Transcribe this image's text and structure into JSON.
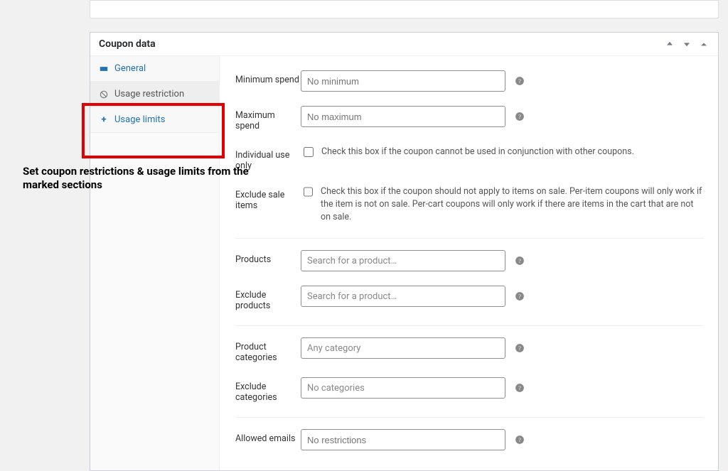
{
  "panel": {
    "title": "Coupon data"
  },
  "tabs": {
    "general": "General",
    "restriction": "Usage restriction",
    "limits": "Usage limits"
  },
  "annotation": "Set coupon restrictions & usage limits from the marked sections",
  "fields": {
    "min_spend": {
      "label": "Minimum spend",
      "placeholder": "No minimum"
    },
    "max_spend": {
      "label": "Maximum spend",
      "placeholder": "No maximum"
    },
    "individual_use": {
      "label": "Individual use only",
      "text": "Check this box if the coupon cannot be used in conjunction with other coupons."
    },
    "exclude_sale": {
      "label": "Exclude sale items",
      "text": "Check this box if the coupon should not apply to items on sale. Per-item coupons will only work if the item is not on sale. Per-cart coupons will only work if there are items in the cart that are not on sale."
    },
    "products": {
      "label": "Products",
      "placeholder": "Search for a product…"
    },
    "exclude_products": {
      "label": "Exclude products",
      "placeholder": "Search for a product…"
    },
    "categories": {
      "label": "Product categories",
      "placeholder": "Any category"
    },
    "exclude_categories": {
      "label": "Exclude categories",
      "placeholder": "No categories"
    },
    "allowed_emails": {
      "label": "Allowed emails",
      "placeholder": "No restrictions"
    }
  }
}
